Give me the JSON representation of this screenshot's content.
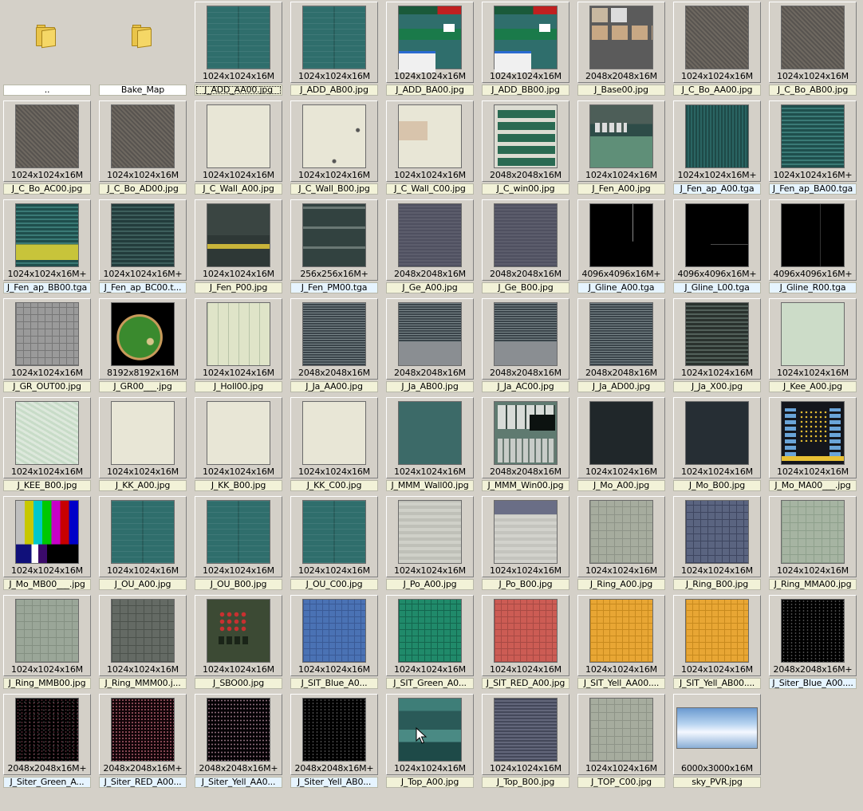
{
  "items": [
    {
      "name": "..",
      "dims": "",
      "thumb": "folder",
      "ext": "plain"
    },
    {
      "name": "Bake_Map",
      "dims": "",
      "thumb": "folder",
      "ext": "plain"
    },
    {
      "name": "J_ADD_AA00.jpg",
      "dims": "1024x1024x16M",
      "thumb": "teal",
      "ext": "jpg",
      "selected": true
    },
    {
      "name": "J_ADD_AB00.jpg",
      "dims": "1024x1024x16M",
      "thumb": "teal",
      "ext": "jpg"
    },
    {
      "name": "J_ADD_BA00.jpg",
      "dims": "1024x1024x16M",
      "thumb": "add-panels",
      "ext": "jpg"
    },
    {
      "name": "J_ADD_BB00.jpg",
      "dims": "1024x1024x16M",
      "thumb": "add-panels",
      "ext": "jpg"
    },
    {
      "name": "J_Base00.jpg",
      "dims": "2048x2048x16M",
      "thumb": "base",
      "ext": "jpg"
    },
    {
      "name": "J_C_Bo_AA00.jpg",
      "dims": "1024x1024x16M",
      "thumb": "gravel",
      "ext": "jpg"
    },
    {
      "name": "J_C_Bo_AB00.jpg",
      "dims": "1024x1024x16M",
      "thumb": "gravel",
      "ext": "jpg"
    },
    {
      "name": "J_C_Bo_AC00.jpg",
      "dims": "1024x1024x16M",
      "thumb": "gravel",
      "ext": "jpg"
    },
    {
      "name": "J_C_Bo_AD00.jpg",
      "dims": "1024x1024x16M",
      "thumb": "gravel",
      "ext": "jpg"
    },
    {
      "name": "J_C_Wall_A00.jpg",
      "dims": "1024x1024x16M",
      "thumb": "cream",
      "ext": "jpg"
    },
    {
      "name": "J_C_Wall_B00.jpg",
      "dims": "1024x1024x16M",
      "thumb": "cream-marks",
      "ext": "jpg"
    },
    {
      "name": "J_C_Wall_C00.jpg",
      "dims": "1024x1024x16M",
      "thumb": "cream-tile",
      "ext": "jpg"
    },
    {
      "name": "J_C_win00.jpg",
      "dims": "2048x2048x16M",
      "thumb": "win",
      "ext": "jpg"
    },
    {
      "name": "J_Fen_A00.jpg",
      "dims": "1024x1024x16M",
      "thumb": "fen",
      "ext": "jpg"
    },
    {
      "name": "J_Fen_ap_A00.tga",
      "dims": "1024x1024x16M+",
      "thumb": "teal-vlines",
      "ext": "tga"
    },
    {
      "name": "J_Fen_ap_BA00.tga",
      "dims": "1024x1024x16M+",
      "thumb": "teal-hlines",
      "ext": "tga"
    },
    {
      "name": "J_Fen_ap_BB00.tga",
      "dims": "1024x1024x16M+",
      "thumb": "teal-yellow",
      "ext": "tga"
    },
    {
      "name": "J_Fen_ap_BC00.t...",
      "dims": "1024x1024x16M+",
      "thumb": "teal-hlines-dark",
      "ext": "tga"
    },
    {
      "name": "J_Fen_P00.jpg",
      "dims": "1024x1024x16M",
      "thumb": "fen-p",
      "ext": "jpg"
    },
    {
      "name": "J_Fen_PM00.tga",
      "dims": "256x256x16M+",
      "thumb": "fen-pm",
      "ext": "tga"
    },
    {
      "name": "J_Ge_A00.jpg",
      "dims": "2048x2048x16M",
      "thumb": "slate",
      "ext": "jpg"
    },
    {
      "name": "J_Ge_B00.jpg",
      "dims": "2048x2048x16M",
      "thumb": "slate",
      "ext": "jpg"
    },
    {
      "name": "J_Gline_A00.tga",
      "dims": "4096x4096x16M+",
      "thumb": "black-line-v",
      "ext": "tga"
    },
    {
      "name": "J_Gline_L00.tga",
      "dims": "4096x4096x16M+",
      "thumb": "black-line-h",
      "ext": "tga"
    },
    {
      "name": "J_Gline_R00.tga",
      "dims": "4096x4096x16M+",
      "thumb": "black-line-r",
      "ext": "tga"
    },
    {
      "name": "J_GR_OUT00.jpg",
      "dims": "1024x1024x16M",
      "thumb": "grey-grid",
      "ext": "jpg"
    },
    {
      "name": "J_GR00___.jpg",
      "dims": "8192x8192x16M",
      "thumb": "field",
      "ext": "jpg"
    },
    {
      "name": "J_Holl00.jpg",
      "dims": "1024x1024x16M",
      "thumb": "holl",
      "ext": "jpg"
    },
    {
      "name": "J_Ja_AA00.jpg",
      "dims": "2048x2048x16M",
      "thumb": "ja",
      "ext": "jpg"
    },
    {
      "name": "J_Ja_AB00.jpg",
      "dims": "2048x2048x16M",
      "thumb": "ja-b",
      "ext": "jpg"
    },
    {
      "name": "J_Ja_AC00.jpg",
      "dims": "2048x2048x16M",
      "thumb": "ja-b",
      "ext": "jpg"
    },
    {
      "name": "J_Ja_AD00.jpg",
      "dims": "2048x2048x16M",
      "thumb": "ja",
      "ext": "jpg"
    },
    {
      "name": "J_Ja_X00.jpg",
      "dims": "1024x1024x16M",
      "thumb": "dark-grid",
      "ext": "jpg"
    },
    {
      "name": "J_Kee_A00.jpg",
      "dims": "1024x1024x16M",
      "thumb": "mint",
      "ext": "jpg"
    },
    {
      "name": "J_KEE_B00.jpg",
      "dims": "1024x1024x16M",
      "thumb": "mint-pattern",
      "ext": "jpg"
    },
    {
      "name": "J_KK_A00.jpg",
      "dims": "1024x1024x16M",
      "thumb": "cream",
      "ext": "jpg"
    },
    {
      "name": "J_KK_B00.jpg",
      "dims": "1024x1024x16M",
      "thumb": "cream",
      "ext": "jpg"
    },
    {
      "name": "J_KK_C00.jpg",
      "dims": "1024x1024x16M",
      "thumb": "cream",
      "ext": "jpg"
    },
    {
      "name": "J_MMM_Wall00.jpg",
      "dims": "1024x1024x16M",
      "thumb": "teal-plain",
      "ext": "jpg"
    },
    {
      "name": "J_MMM_Win00.jpg",
      "dims": "2048x2048x16M",
      "thumb": "mmm-win",
      "ext": "jpg"
    },
    {
      "name": "J_Mo_A00.jpg",
      "dims": "1024x1024x16M",
      "thumb": "very-dark",
      "ext": "jpg"
    },
    {
      "name": "J_Mo_B00.jpg",
      "dims": "1024x1024x16M",
      "thumb": "very-dark-2",
      "ext": "jpg"
    },
    {
      "name": "J_Mo_MA00___.jpg",
      "dims": "1024x1024x16M",
      "thumb": "scoreboard",
      "ext": "jpg"
    },
    {
      "name": "J_Mo_MB00___.jpg",
      "dims": "1024x1024x16M",
      "thumb": "colorbars",
      "ext": "jpg"
    },
    {
      "name": "J_OU_A00.jpg",
      "dims": "1024x1024x16M",
      "thumb": "teal",
      "ext": "jpg"
    },
    {
      "name": "J_OU_B00.jpg",
      "dims": "1024x1024x16M",
      "thumb": "teal",
      "ext": "jpg"
    },
    {
      "name": "J_OU_C00.jpg",
      "dims": "1024x1024x16M",
      "thumb": "teal",
      "ext": "jpg"
    },
    {
      "name": "J_Po_A00.jpg",
      "dims": "1024x1024x16M",
      "thumb": "light-grey",
      "ext": "jpg"
    },
    {
      "name": "J_Po_B00.jpg",
      "dims": "1024x1024x16M",
      "thumb": "po-b",
      "ext": "jpg"
    },
    {
      "name": "J_Ring_A00.jpg",
      "dims": "1024x1024x16M",
      "thumb": "grey-green",
      "ext": "jpg"
    },
    {
      "name": "J_Ring_B00.jpg",
      "dims": "1024x1024x16M",
      "thumb": "blue-grey",
      "ext": "jpg"
    },
    {
      "name": "J_Ring_MMA00.jpg",
      "dims": "1024x1024x16M",
      "thumb": "sage",
      "ext": "jpg"
    },
    {
      "name": "J_Ring_MMB00.jpg",
      "dims": "1024x1024x16M",
      "thumb": "sage-2",
      "ext": "jpg"
    },
    {
      "name": "J_Ring_MMM00.j...",
      "dims": "1024x1024x16M",
      "thumb": "grey-dark-grid",
      "ext": "jpg"
    },
    {
      "name": "J_SBO00.jpg",
      "dims": "1024x1024x16M",
      "thumb": "sbo",
      "ext": "jpg"
    },
    {
      "name": "J_SIT_Blue_A0...",
      "dims": "1024x1024x16M",
      "thumb": "seat-blue",
      "ext": "jpg"
    },
    {
      "name": "J_SIT_Green_A0...",
      "dims": "1024x1024x16M",
      "thumb": "seat-green",
      "ext": "jpg"
    },
    {
      "name": "J_SIT_RED_A00.jpg",
      "dims": "1024x1024x16M",
      "thumb": "seat-red",
      "ext": "jpg"
    },
    {
      "name": "J_SIT_Yell_AA00....",
      "dims": "1024x1024x16M",
      "thumb": "seat-yellow",
      "ext": "jpg"
    },
    {
      "name": "J_SIT_Yell_AB00....",
      "dims": "1024x1024x16M",
      "thumb": "seat-yellow",
      "ext": "jpg"
    },
    {
      "name": "J_Siter_Blue_A00....",
      "dims": "2048x2048x16M+",
      "thumb": "siter",
      "ext": "tga"
    },
    {
      "name": "J_Siter_Green_A...",
      "dims": "2048x2048x16M+",
      "thumb": "siter-2",
      "ext": "tga"
    },
    {
      "name": "J_Siter_RED_A00...",
      "dims": "2048x2048x16M+",
      "thumb": "siter-red",
      "ext": "tga"
    },
    {
      "name": "J_Siter_Yell_AA0...",
      "dims": "2048x2048x16M+",
      "thumb": "siter-3",
      "ext": "tga"
    },
    {
      "name": "J_Siter_Yell_AB0...",
      "dims": "2048x2048x16M+",
      "thumb": "siter",
      "ext": "tga"
    },
    {
      "name": "J_Top_A00.jpg",
      "dims": "1024x1024x16M",
      "thumb": "top-a",
      "ext": "jpg"
    },
    {
      "name": "J_Top_B00.jpg",
      "dims": "1024x1024x16M",
      "thumb": "top-b",
      "ext": "jpg"
    },
    {
      "name": "J_TOP_C00.jpg",
      "dims": "1024x1024x16M",
      "thumb": "grey-green",
      "ext": "jpg"
    },
    {
      "name": "sky_PVR.jpg",
      "dims": "6000x3000x16M",
      "thumb": "sky",
      "ext": "jpg"
    }
  ]
}
